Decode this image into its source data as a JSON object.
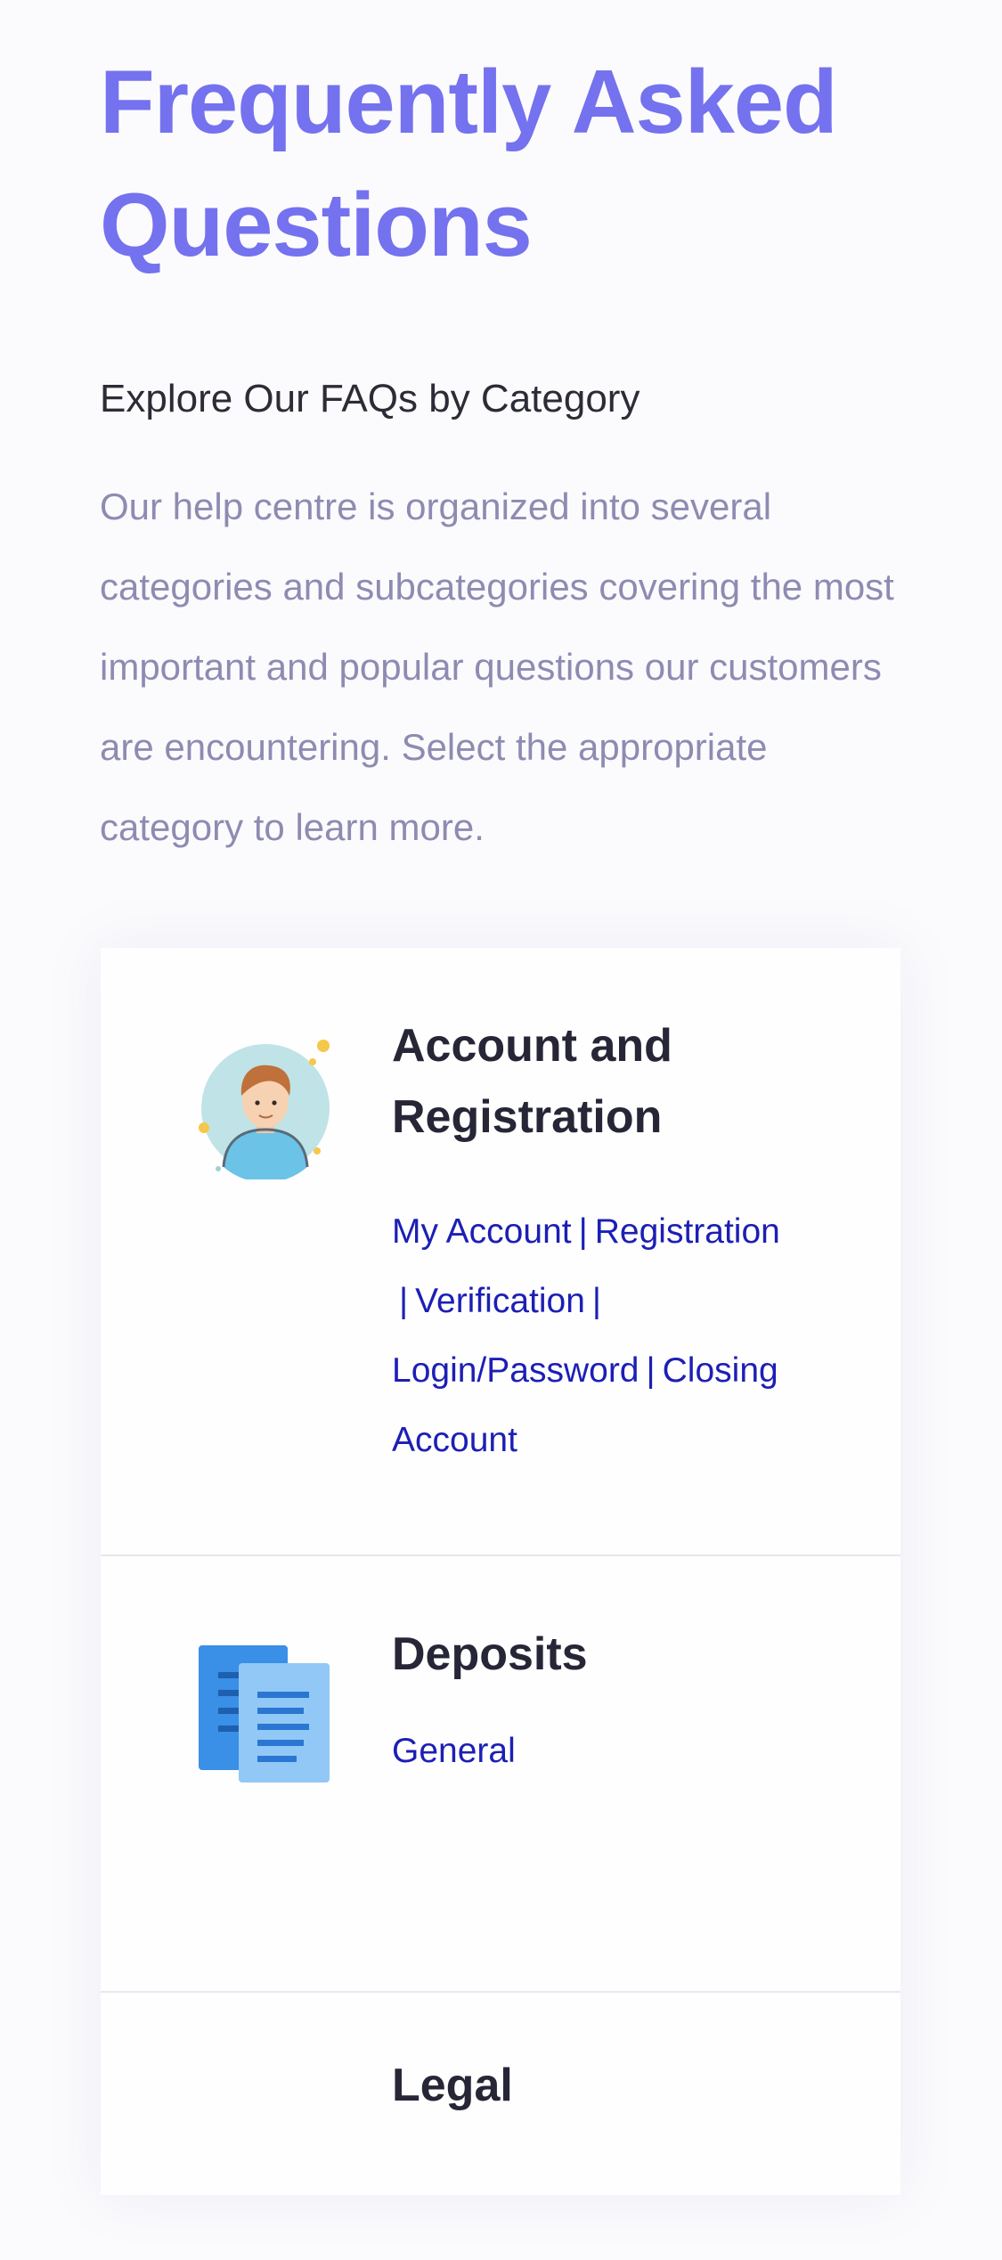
{
  "header": {
    "title": "Frequently Asked Questions"
  },
  "section": {
    "subheading": "Explore Our FAQs by Category",
    "intro": "Our help centre is organized into several categories and subcategories covering the most important and popular questions our customers are encountering. Select the appropriate category to learn more."
  },
  "categories": [
    {
      "title": "Account and Registration",
      "icon": "user-avatar-icon",
      "links": [
        "My Account",
        "Registration",
        "Verification",
        "Login/Password",
        "Closing Account"
      ]
    },
    {
      "title": "Deposits",
      "icon": "documents-icon",
      "links": [
        "General"
      ]
    },
    {
      "title": "Legal",
      "icon": "",
      "links": []
    }
  ],
  "separator": "|",
  "colors": {
    "accent": "#7472ee",
    "link": "#1c1fb4",
    "muted_text": "#8e8bb2",
    "heading_text": "#262637"
  }
}
